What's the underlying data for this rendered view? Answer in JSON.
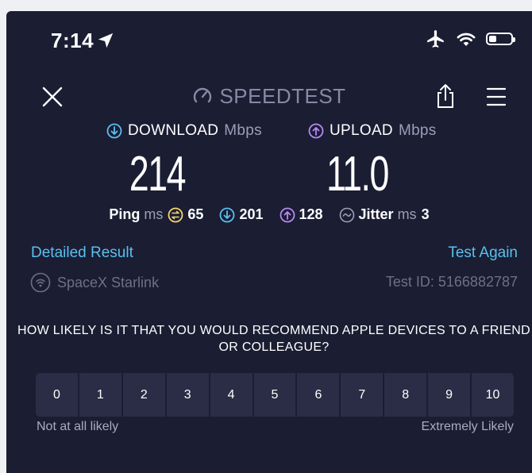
{
  "status_bar": {
    "time": "7:14",
    "battery_level": 0.3
  },
  "header": {
    "brand": "SPEEDTEST"
  },
  "download": {
    "label": "DOWNLOAD",
    "unit": "Mbps",
    "value": "214",
    "color": "#58c1ef"
  },
  "upload": {
    "label": "UPLOAD",
    "unit": "Mbps",
    "value": "11.0",
    "color": "#b889f5"
  },
  "ping": {
    "label": "Ping",
    "unit": "ms",
    "idle": "65",
    "download": "201",
    "upload": "128",
    "jitter_label": "Jitter",
    "jitter_unit": "ms",
    "jitter": "3",
    "idle_color": "#f5d76e"
  },
  "links": {
    "detailed": "Detailed Result",
    "again": "Test Again"
  },
  "connection": {
    "isp": "SpaceX Starlink",
    "test_id": "Test ID: 5166882787"
  },
  "survey": {
    "question": "HOW LIKELY IS IT THAT YOU WOULD RECOMMEND APPLE DEVICES TO A FRIEND OR COLLEAGUE?",
    "scale": [
      "0",
      "1",
      "2",
      "3",
      "4",
      "5",
      "6",
      "7",
      "8",
      "9",
      "10"
    ],
    "low_label": "Not at all likely",
    "high_label": "Extremely Likely"
  }
}
